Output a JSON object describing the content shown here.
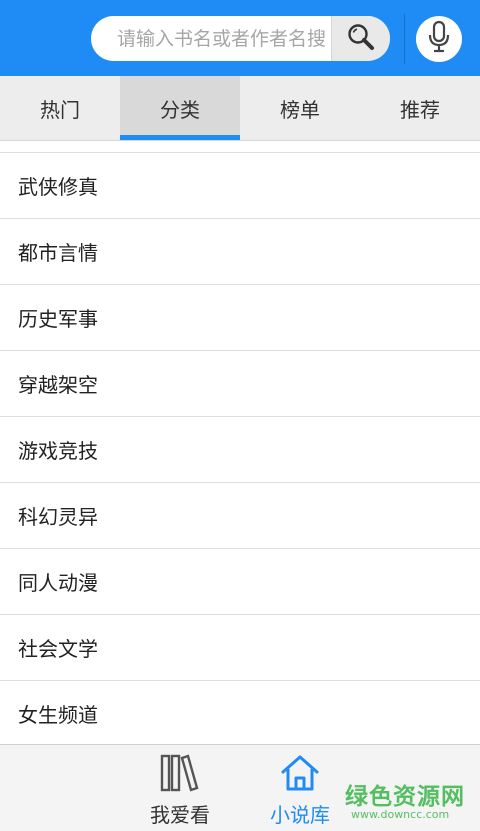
{
  "search": {
    "placeholder": "请输入书名或者作者名搜"
  },
  "tabs": [
    {
      "label": "热门",
      "active": false
    },
    {
      "label": "分类",
      "active": true
    },
    {
      "label": "榜单",
      "active": false
    },
    {
      "label": "推荐",
      "active": false
    }
  ],
  "categories": [
    "武侠修真",
    "都市言情",
    "历史军事",
    "穿越架空",
    "游戏竞技",
    "科幻灵异",
    "同人动漫",
    "社会文学",
    "女生频道"
  ],
  "bottom_nav": [
    {
      "label": "我爱看",
      "icon": "bookshelf-icon",
      "active": false
    },
    {
      "label": "小说库",
      "icon": "home-icon",
      "active": true
    }
  ],
  "watermark": {
    "text": "绿色资源网",
    "url": "www.downcc.com"
  },
  "colors": {
    "accent": "#1f8cf5",
    "watermark": "#3ab549"
  }
}
